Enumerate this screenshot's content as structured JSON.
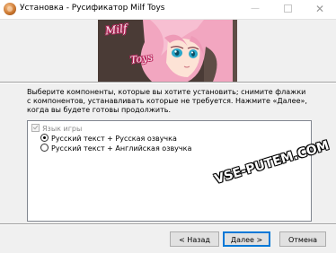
{
  "window": {
    "title": "Установка - Русификатор Milf Toys",
    "minimize_glyph": "—",
    "close_glyph": "✕"
  },
  "banner": {
    "logo_line1": "Milf",
    "logo_line2": "Toys"
  },
  "instructions": "Выберите компоненты, которые вы хотите установить; снимите флажки с компонентов, устанавливать которые не требуется. Нажмите «Далее», когда вы будете готовы продолжить.",
  "components": {
    "group_label": "Язык игры",
    "group_checked": true,
    "options": [
      {
        "label": "Русский текст + Русская озвучка",
        "selected": true
      },
      {
        "label": "Русский текст + Английская озвучка",
        "selected": false
      }
    ]
  },
  "watermark": "VSE-PUTEM.COM",
  "buttons": {
    "back": "< Назад",
    "next": "Далее >",
    "cancel": "Отмена"
  },
  "colors": {
    "accent": "#0078d7",
    "window_bg": "#f0f0f0",
    "banner_hair": "#f4a9c3",
    "logo_outline": "#b8235a"
  },
  "icons": {
    "app": "installer-app-icon",
    "minimize": "minimize-icon",
    "maximize": "maximize-icon",
    "close": "close-icon"
  }
}
